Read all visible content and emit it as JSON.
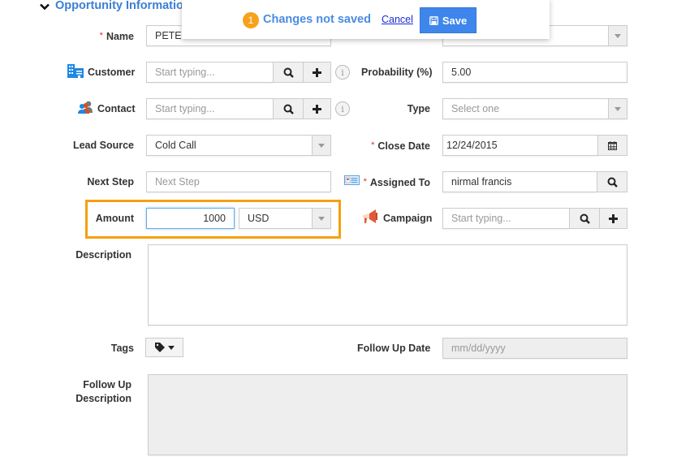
{
  "section": {
    "title": "Opportunity Information",
    "collapse_icon": "chevron-down-icon"
  },
  "notification": {
    "count": "1",
    "message": "Changes not saved",
    "cancel_label": "Cancel",
    "save_label": "Save",
    "save_icon": "floppy-disk-icon"
  },
  "fields": {
    "name": {
      "label": "Name",
      "required": "*",
      "value": "PETE"
    },
    "stage": {
      "value": ""
    },
    "customer": {
      "label": "Customer",
      "icon": "building-icon",
      "placeholder": "Start typing..."
    },
    "probability": {
      "label": "Probability (%)",
      "value": "5.00"
    },
    "contact": {
      "label": "Contact",
      "icon": "contacts-icon",
      "placeholder": "Start typing..."
    },
    "type": {
      "label": "Type",
      "placeholder": "Select one"
    },
    "lead_source": {
      "label": "Lead Source",
      "value": "Cold Call"
    },
    "close_date": {
      "label": "Close Date",
      "required": "*",
      "value": "12/24/2015"
    },
    "next_step": {
      "label": "Next Step",
      "placeholder": "Next Step"
    },
    "assigned_to": {
      "label": "Assigned To",
      "required": "*",
      "icon": "id-card-icon",
      "value": "nirmal francis"
    },
    "amount": {
      "label": "Amount",
      "value": "1000",
      "currency": "USD"
    },
    "campaign": {
      "label": "Campaign",
      "icon": "megaphone-icon",
      "placeholder": "Start typing..."
    },
    "description": {
      "label": "Description",
      "value": ""
    },
    "tags": {
      "label": "Tags",
      "icon": "tag-icon"
    },
    "follow_up_date": {
      "label": "Follow Up Date",
      "placeholder": "mm/dd/yyyy"
    },
    "follow_up_description": {
      "label_line1": "Follow Up",
      "label_line2": "Description",
      "value": ""
    }
  },
  "colors": {
    "accent": "#3a7fd6",
    "save_button": "#3e86eb",
    "badge": "#f7a21b",
    "highlight": "#f5a00f",
    "required": "#d9312b"
  }
}
